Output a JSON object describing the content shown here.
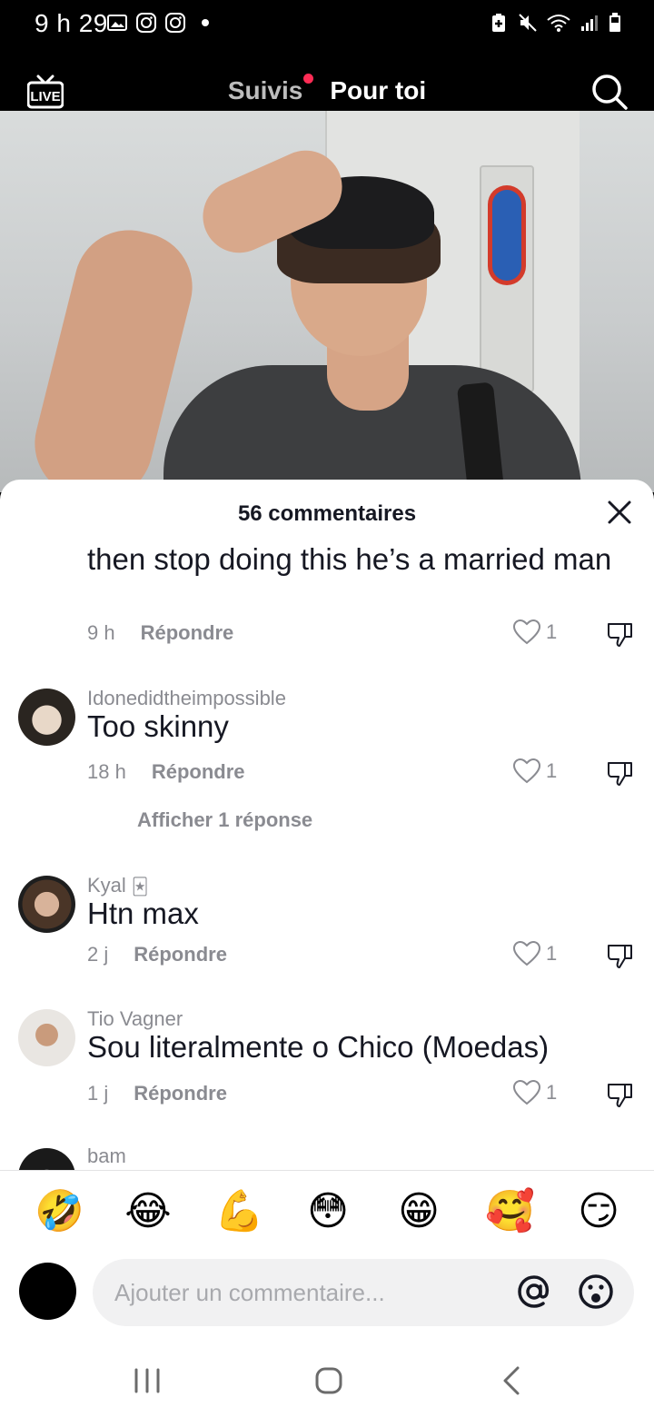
{
  "status_bar": {
    "time": "9 h 29",
    "left_icons": [
      "gallery-icon",
      "instagram-icon",
      "instagram-icon"
    ],
    "right_icons": [
      "battery-saver-icon",
      "mute-icon",
      "wifi-icon",
      "signal-icon",
      "battery-icon"
    ]
  },
  "top_nav": {
    "live_label": "LIVE",
    "tabs": [
      {
        "label": "Suivis",
        "active": false,
        "has_notification_dot": true
      },
      {
        "label": "Pour toi",
        "active": true
      }
    ]
  },
  "comments_sheet": {
    "title": "56 commentaires",
    "comments": [
      {
        "username": "",
        "text": "then stop doing this he’s a married man",
        "time": "9 h",
        "reply_label": "Répondre",
        "likes": "1"
      },
      {
        "username": "Idonedidtheimpossible",
        "text": "Too skinny",
        "time": "18 h",
        "reply_label": "Répondre",
        "likes": "1",
        "view_replies": "Afficher 1 réponse"
      },
      {
        "username": "Kyal",
        "badge": "🃏",
        "text": "Htn max",
        "time": "2 j",
        "reply_label": "Répondre",
        "likes": "1"
      },
      {
        "username": "Tio Vagner",
        "text": "Sou literalmente o Chico (Moedas)",
        "time": "1 j",
        "reply_label": "Répondre",
        "likes": "1"
      },
      {
        "username": "bam"
      }
    ],
    "quick_emojis": [
      "🤣",
      "😂",
      "💪",
      "😳",
      "😁",
      "🥰",
      "😏"
    ],
    "composer": {
      "placeholder": "Ajouter un commentaire..."
    }
  },
  "system_nav": [
    "recent-apps-icon",
    "home-icon",
    "back-icon"
  ],
  "colors": {
    "accent_red": "#fe2c55",
    "text_primary": "#161823",
    "text_secondary": "#8a8b91"
  }
}
